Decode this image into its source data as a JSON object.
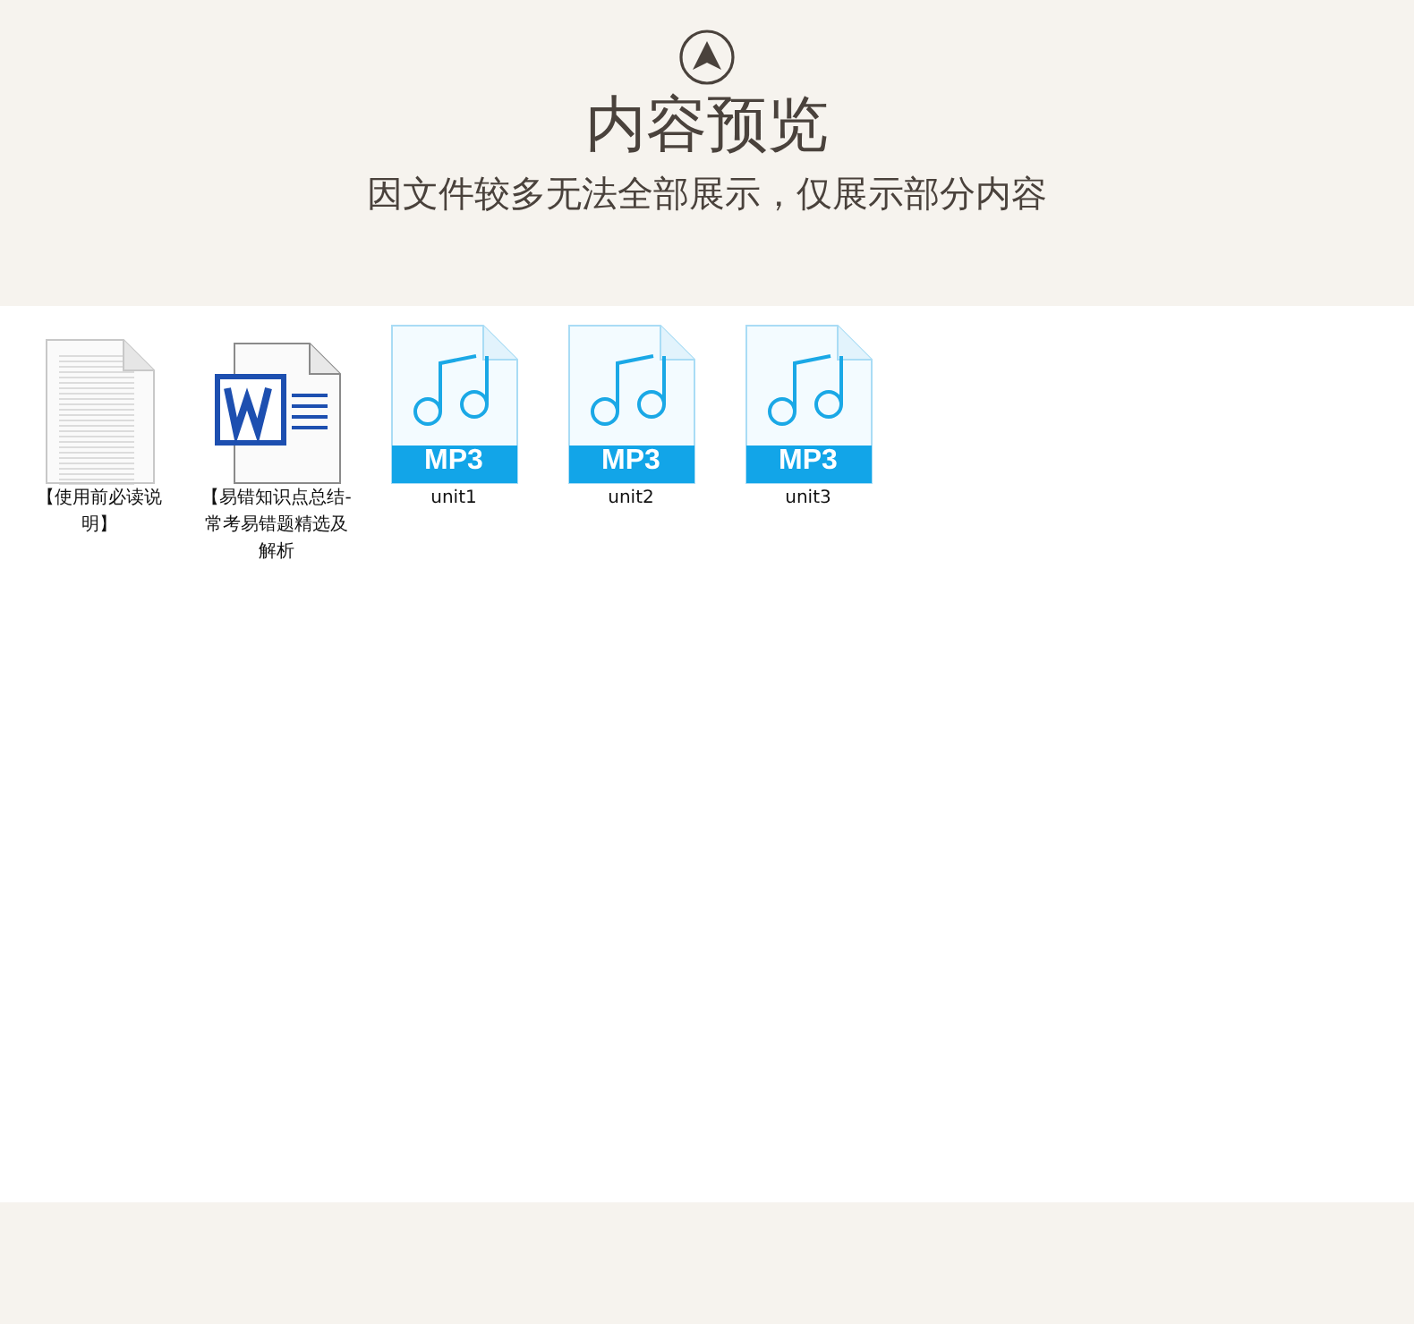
{
  "header": {
    "title": "内容预览",
    "subtitle": "因文件较多无法全部展示，仅展示部分内容"
  },
  "files": [
    {
      "kind": "text",
      "name": "【使用前必读说明】"
    },
    {
      "kind": "word",
      "name": "【易错知识点总结-常考易错题精选及解析"
    },
    {
      "kind": "mp3",
      "name": "unit1",
      "badge": "MP3"
    },
    {
      "kind": "mp3",
      "name": "unit2",
      "badge": "MP3"
    },
    {
      "kind": "mp3",
      "name": "unit3",
      "badge": "MP3"
    }
  ]
}
